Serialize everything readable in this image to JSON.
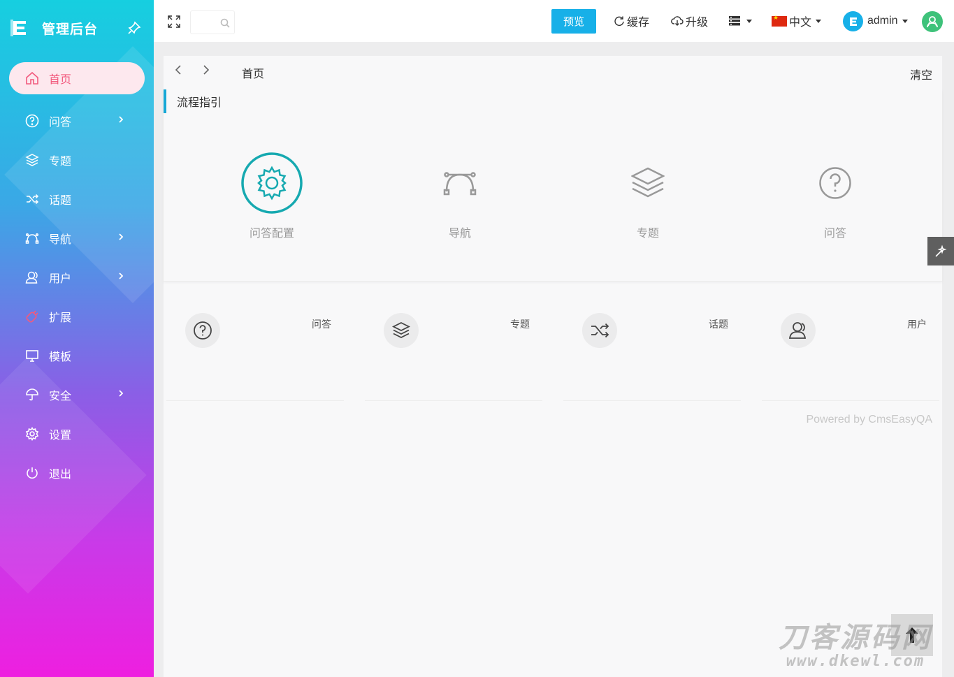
{
  "sidebar": {
    "brand": "管理后台",
    "items": [
      {
        "label": "首页",
        "icon": "home-icon",
        "active": true
      },
      {
        "label": "问答",
        "icon": "question-circle-icon",
        "has_children": true
      },
      {
        "label": "专题",
        "icon": "layers-icon"
      },
      {
        "label": "话题",
        "icon": "shuffle-icon"
      },
      {
        "label": "导航",
        "icon": "bezier-curve-icon",
        "has_children": true
      },
      {
        "label": "用户",
        "icon": "user-icon",
        "has_children": true
      },
      {
        "label": "扩展",
        "icon": "puzzle-icon"
      },
      {
        "label": "模板",
        "icon": "monitor-icon"
      },
      {
        "label": "安全",
        "icon": "umbrella-icon",
        "has_children": true
      },
      {
        "label": "设置",
        "icon": "gear-icon"
      },
      {
        "label": "退出",
        "icon": "power-icon"
      }
    ]
  },
  "header": {
    "preview_label": "预览",
    "cache_label": "缓存",
    "upgrade_label": "升级",
    "language_label": "中文",
    "username": "admin"
  },
  "tabs": {
    "home": "首页",
    "clear": "清空"
  },
  "guide": {
    "title": "流程指引",
    "items": [
      {
        "label": "问答配置",
        "icon": "gear-icon"
      },
      {
        "label": "导航",
        "icon": "bezier-curve-icon"
      },
      {
        "label": "专题",
        "icon": "layers-icon"
      },
      {
        "label": "问答",
        "icon": "question-circle-icon"
      }
    ]
  },
  "stats": [
    {
      "label": "问答",
      "icon": "question-circle-icon"
    },
    {
      "label": "专题",
      "icon": "layers-icon"
    },
    {
      "label": "话题",
      "icon": "shuffle-icon"
    },
    {
      "label": "用户",
      "icon": "user-icon"
    }
  ],
  "footer": {
    "powered": "Powered by CmsEasyQA"
  },
  "watermark": {
    "line1": "刀客源码网",
    "line2": "www.dkewl.com"
  },
  "colors": {
    "accent": "#17b0e8",
    "guide_teal": "#16a9b0",
    "active_text": "#f25a7e",
    "active_bg": "#fde8ee"
  }
}
